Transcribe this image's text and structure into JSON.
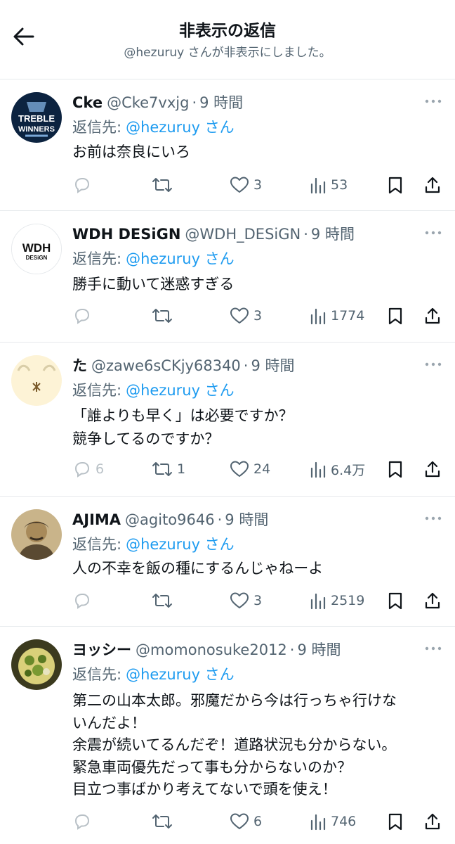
{
  "header": {
    "title": "非表示の返信",
    "subtitle": "@hezuruy さんが非表示にしました。"
  },
  "tweets": [
    {
      "name": "Cke",
      "handle": "@Cke7vxjg",
      "dot": "·",
      "time": "9 時間",
      "reply_label": "返信先:",
      "reply_to": "@hezuruy さん",
      "lines": [
        "お前は奈良にいろ"
      ],
      "replies": "",
      "retweets": "",
      "likes": "3",
      "views": "53",
      "avatar": {
        "type": "badge",
        "text1": "TREBLE",
        "text2": "WINNERS",
        "bg": "#0c2340"
      }
    },
    {
      "name": "WDH DESiGN",
      "handle": "@WDH_DESiGN",
      "dot": "·",
      "time": "9 時間",
      "reply_label": "返信先:",
      "reply_to": "@hezuruy さん",
      "lines": [
        "勝手に動いて迷惑すぎる"
      ],
      "replies": "",
      "retweets": "",
      "likes": "3",
      "views": "1774",
      "avatar": {
        "type": "logo",
        "text1": "WDH",
        "text2": "DESiGN",
        "bg": "#ffffff"
      }
    },
    {
      "name": "た",
      "handle": "@zawe6sCKjy68340",
      "dot": "·",
      "time": "9 時間",
      "reply_label": "返信先:",
      "reply_to": "@hezuruy さん",
      "lines": [
        "「誰よりも早く」は必要ですか？",
        "競争してるのですか？"
      ],
      "replies": "6",
      "retweets": "1",
      "likes": "24",
      "views": "6.4万",
      "avatar": {
        "type": "cute",
        "bg": "#fdf3d6"
      }
    },
    {
      "name": "AJIMA",
      "handle": "@agito9646",
      "dot": "·",
      "time": "9 時間",
      "reply_label": "返信先:",
      "reply_to": "@hezuruy さん",
      "lines": [
        "人の不幸を飯の種にするんじゃねーよ"
      ],
      "replies": "",
      "retweets": "",
      "likes": "3",
      "views": "2519",
      "avatar": {
        "type": "portrait",
        "bg": "#c9b48a"
      }
    },
    {
      "name": "ヨッシー",
      "handle": "@momonosuke2012",
      "dot": "·",
      "time": "9 時間",
      "reply_label": "返信先:",
      "reply_to": "@hezuruy さん",
      "lines": [
        "第二の山本太郎。邪魔だから今は行っちゃ行けな",
        "いんだよ！",
        "余震が続いてるんだぞ！道路状況も分からない。",
        "緊急車両優先だって事も分からないのか？",
        "目立つ事ばかり考えてないで頭を使え！"
      ],
      "replies": "",
      "retweets": "",
      "likes": "6",
      "views": "746",
      "avatar": {
        "type": "food",
        "bg": "#3b3a1e"
      }
    }
  ],
  "colors": {
    "text": "#0f1419",
    "muted": "#536471",
    "link": "#1d9bf0",
    "divider": "#e6e9ec"
  }
}
